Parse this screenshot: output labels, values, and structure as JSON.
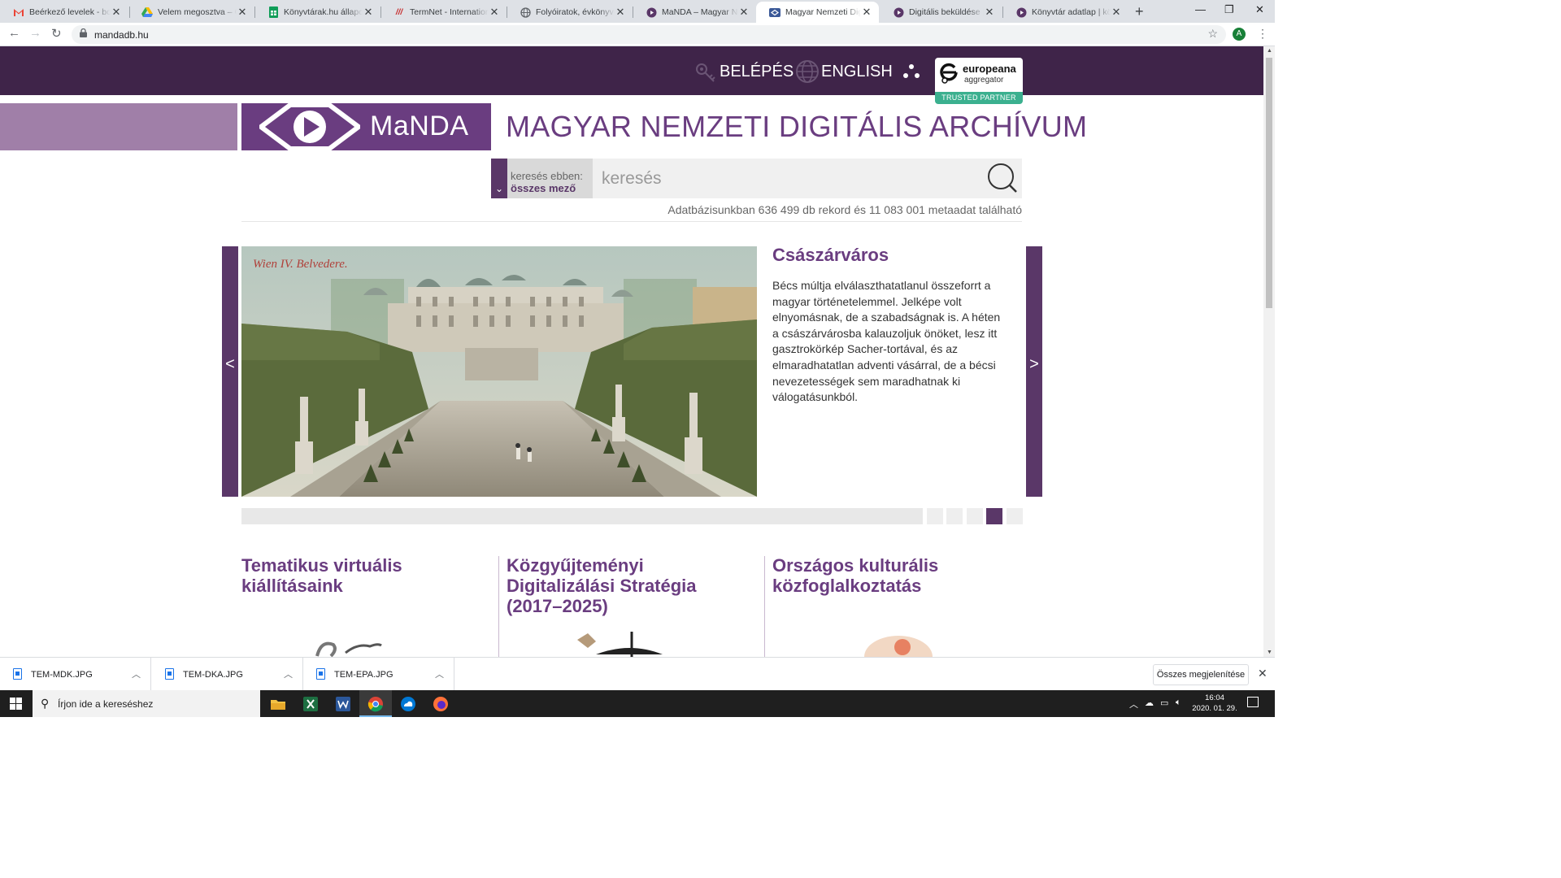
{
  "browser": {
    "tabs": [
      {
        "title": "Beérkező levelek - bodi",
        "icon": "gmail-icon"
      },
      {
        "title": "Velem megosztva – Goo",
        "icon": "google-drive-icon"
      },
      {
        "title": "Könyvtárak.hu állapot -",
        "icon": "google-sheets-icon"
      },
      {
        "title": "TermNet - International",
        "icon": "termnet-icon"
      },
      {
        "title": "Folyóiratok, évkönyvek",
        "icon": "globe-icon"
      },
      {
        "title": "MaNDA – Magyar Nemz",
        "icon": "manda-icon"
      },
      {
        "title": "Magyar Nemzeti Digitá",
        "icon": "manda-icon",
        "active": true
      },
      {
        "title": "Digitális beküldése | kö",
        "icon": "manda-icon"
      },
      {
        "title": "Könyvtár adatlap | köny",
        "icon": "manda-icon"
      }
    ],
    "url": "mandadb.hu",
    "profile_initial": "A"
  },
  "header": {
    "login_label": "BELÉPÉS",
    "language_label": "ENGLISH",
    "europeana": {
      "name": "europeana",
      "sub": "aggregator",
      "badge": "TRUSTED PARTNER"
    }
  },
  "brand": {
    "logo_text": "MaNDA",
    "site_title": "MAGYAR NEMZETI DIGITÁLIS ARCHÍVUM"
  },
  "search": {
    "scope_label": "keresés ebben:",
    "scope_value": "összes mező",
    "placeholder": "keresés",
    "stats": "Adatbázisunkban 636 499 db rekord és 11 083 001 metaadat található"
  },
  "slider": {
    "title": "Császárváros",
    "text": "Bécs múltja elválaszthatatlanul összeforrt a magyar történetelemmel. Jelképe volt elnyomásnak, de a szabadságnak is. A héten a császárvárosba kalauzoljuk önöket, lesz itt gasztrokörkép Sacher-tortával, és az elmaradhatatlan adventi vásárral, de a bécsi nevezetességek sem maradhatnak ki válogatásunkból.",
    "image_caption": "Wien IV. Belvedere.",
    "prev": "<",
    "next": ">",
    "dots_total": 5,
    "dots_active_index": 3
  },
  "columns": [
    {
      "title": "Tematikus virtuális kiállításaink"
    },
    {
      "title": "Közgyűjteményi Digitalizálási Stratégia (2017–2025)"
    },
    {
      "title": "Országos kulturális közfoglalkoztatás"
    }
  ],
  "downloads": {
    "items": [
      "TEM-MDK.JPG",
      "TEM-DKA.JPG",
      "TEM-EPA.JPG"
    ],
    "show_all": "Összes megjelenítése"
  },
  "taskbar": {
    "search_placeholder": "Írjon ide a kereséshez",
    "time": "16:04",
    "date": "2020. 01. 29.",
    "apps": [
      "file-explorer-icon",
      "excel-icon",
      "word-icon",
      "chrome-icon",
      "onedrive-icon",
      "firefox-icon"
    ]
  },
  "colors": {
    "brand_dark": "#3f2449",
    "brand_purple": "#6a3d80",
    "brand_light": "#a07fa8",
    "europeana_green": "#3bb08f"
  }
}
